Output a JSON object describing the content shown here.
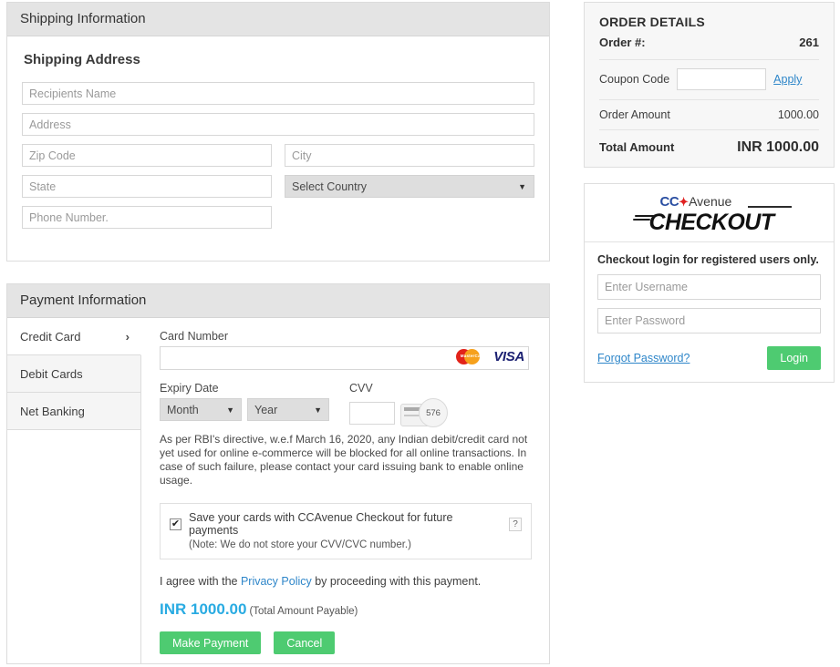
{
  "shipping": {
    "panel_title": "Shipping Information",
    "section_title": "Shipping Address",
    "fields": {
      "recipient_placeholder": "Recipients Name",
      "address_placeholder": "Address",
      "zip_placeholder": "Zip Code",
      "city_placeholder": "City",
      "state_placeholder": "State",
      "country_selected": "Select Country",
      "phone_placeholder": "Phone Number."
    }
  },
  "payment": {
    "panel_title": "Payment Information",
    "tabs": [
      {
        "label": "Credit Card",
        "active": true,
        "chevron": "›"
      },
      {
        "label": "Debit Cards",
        "active": false
      },
      {
        "label": "Net Banking",
        "active": false
      }
    ],
    "card_number_label": "Card Number",
    "card_number_value": "",
    "brands": {
      "mastercard": "MasterCard",
      "visa": "VISA"
    },
    "expiry_label": "Expiry Date",
    "month_selected": "Month",
    "year_selected": "Year",
    "cvv_label": "CVV",
    "cvv_value": "",
    "cvv_hint_digits": "576",
    "rbi_note": "As per RBI's directive, w.e.f March 16, 2020, any Indian debit/credit card not yet used for online e-commerce will be blocked for all online transactions. In case of such failure, please contact your card issuing bank to enable online usage.",
    "save_checkbox_checked": "✔",
    "save_label": "Save your cards with CCAvenue Checkout for future payments",
    "save_help": "?",
    "save_note": "(Note: We do not store your CVV/CVC number.)",
    "agree_prefix": "I agree with the ",
    "privacy_link": "Privacy Policy",
    "agree_suffix": " by proceeding with this payment.",
    "amount_big": "INR 1000.00",
    "amount_sub": "(Total Amount Payable)",
    "make_payment_label": "Make Payment",
    "cancel_label": "Cancel"
  },
  "order": {
    "title": "ORDER DETAILS",
    "order_no_label": "Order #:",
    "order_no_value": "261",
    "coupon_label": "Coupon Code",
    "coupon_value": "",
    "apply_label": "Apply",
    "amount_label": "Order  Amount",
    "amount_value": "1000.00",
    "total_label": "Total Amount",
    "total_value": "INR 1000.00"
  },
  "login": {
    "logo_cc": "CC",
    "logo_star": "✦",
    "logo_avenue": "Avenue",
    "logo_checkout": "CHECKOUT",
    "heading": "Checkout login for registered users only.",
    "username_placeholder": "Enter Username",
    "username_value": "",
    "password_placeholder": "Enter Password",
    "password_value": "",
    "forgot_label": "Forgot Password?",
    "login_label": "Login"
  },
  "colors": {
    "accent_green": "#4ecb71",
    "link_blue": "#2e86c9",
    "amount_blue": "#29abe2",
    "header_gray": "#e4e4e4"
  }
}
